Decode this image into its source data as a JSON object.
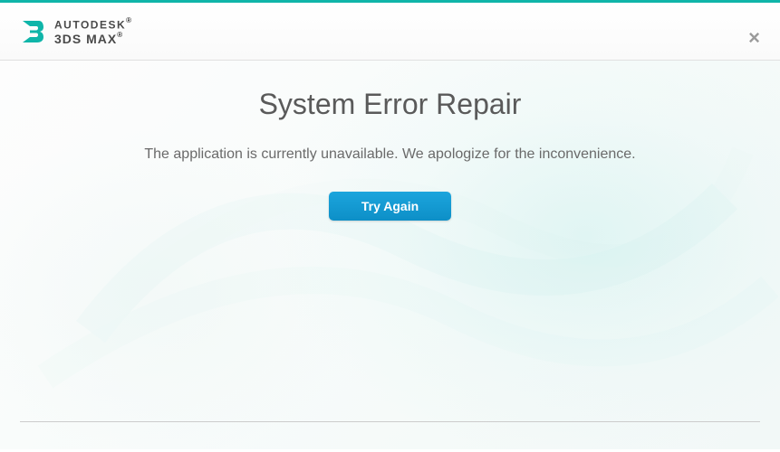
{
  "header": {
    "brand_top": "AUTODESK",
    "brand_product": "3DS MAX"
  },
  "error": {
    "title": "System Error Repair",
    "message": "The application is currently unavailable. We apologize for the inconvenience.",
    "retry_label": "Try Again"
  },
  "colors": {
    "accent_teal": "#0fb5a9",
    "button_blue": "#1399d3"
  }
}
